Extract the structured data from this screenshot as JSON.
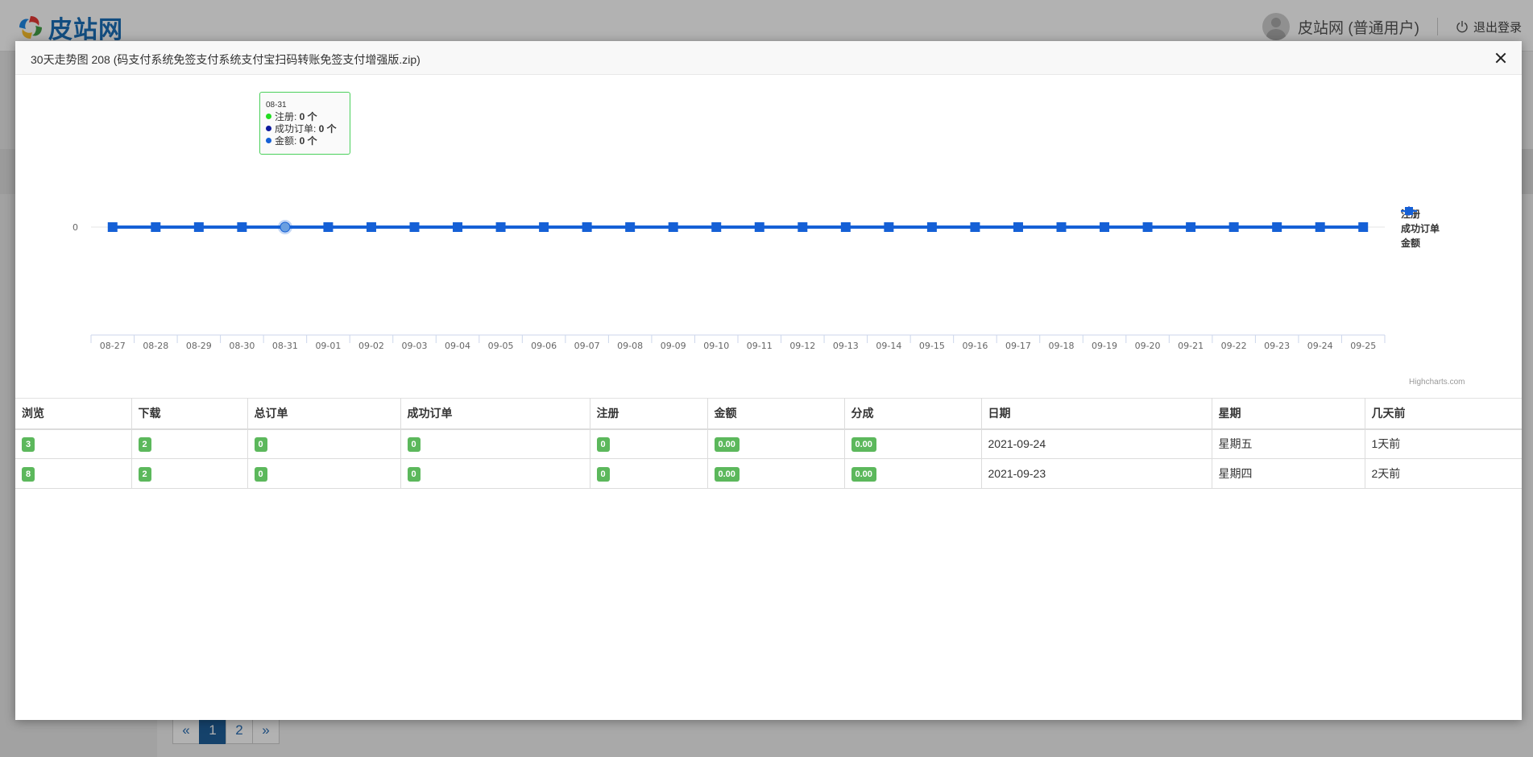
{
  "site": {
    "logo_text": "皮站网",
    "user_label": "皮站网 (普通用户)",
    "logout_label": "退出登录"
  },
  "pagination": {
    "prev": "«",
    "pages": [
      "1",
      "2"
    ],
    "active": "1",
    "next": "»"
  },
  "modal": {
    "title": "30天走势图 208 (码支付系统免签支付系统支付宝扫码转账免签支付增强版.zip)"
  },
  "colors": {
    "register": "#22dd22",
    "orders": "#0d1a9e",
    "amount": "#1560d6",
    "badge": "#5cb85c"
  },
  "tooltip": {
    "date": "08-31",
    "rows": [
      {
        "label": "注册: ",
        "value": "0 个"
      },
      {
        "label": "成功订单: ",
        "value": "0 个"
      },
      {
        "label": "金额: ",
        "value": "0 个"
      }
    ]
  },
  "chart_data": {
    "type": "line",
    "categories": [
      "08-27",
      "08-28",
      "08-29",
      "08-30",
      "08-31",
      "09-01",
      "09-02",
      "09-03",
      "09-04",
      "09-05",
      "09-06",
      "09-07",
      "09-08",
      "09-09",
      "09-10",
      "09-11",
      "09-12",
      "09-13",
      "09-14",
      "09-15",
      "09-16",
      "09-17",
      "09-18",
      "09-19",
      "09-20",
      "09-21",
      "09-22",
      "09-23",
      "09-24",
      "09-25"
    ],
    "series": [
      {
        "name": "注册",
        "values": [
          0,
          0,
          0,
          0,
          0,
          0,
          0,
          0,
          0,
          0,
          0,
          0,
          0,
          0,
          0,
          0,
          0,
          0,
          0,
          0,
          0,
          0,
          0,
          0,
          0,
          0,
          0,
          0,
          0,
          0
        ]
      },
      {
        "name": "成功订单",
        "values": [
          0,
          0,
          0,
          0,
          0,
          0,
          0,
          0,
          0,
          0,
          0,
          0,
          0,
          0,
          0,
          0,
          0,
          0,
          0,
          0,
          0,
          0,
          0,
          0,
          0,
          0,
          0,
          0,
          0,
          0
        ]
      },
      {
        "name": "金额",
        "values": [
          0,
          0,
          0,
          0,
          0,
          0,
          0,
          0,
          0,
          0,
          0,
          0,
          0,
          0,
          0,
          0,
          0,
          0,
          0,
          0,
          0,
          0,
          0,
          0,
          0,
          0,
          0,
          0,
          0,
          0
        ]
      }
    ],
    "yticks": [
      "0"
    ],
    "highlighted_category": "08-31",
    "legend_position": "right",
    "credits": "Highcharts.com"
  },
  "table": {
    "headers": [
      "浏览",
      "下载",
      "总订单",
      "成功订单",
      "注册",
      "金额",
      "分成",
      "日期",
      "星期",
      "几天前"
    ],
    "rows": [
      [
        "3",
        "2",
        "0",
        "0",
        "0",
        "0.00",
        "0.00",
        "2021-09-24",
        "星期五",
        "1天前"
      ],
      [
        "8",
        "2",
        "0",
        "0",
        "0",
        "0.00",
        "0.00",
        "2021-09-23",
        "星期四",
        "2天前"
      ]
    ]
  }
}
